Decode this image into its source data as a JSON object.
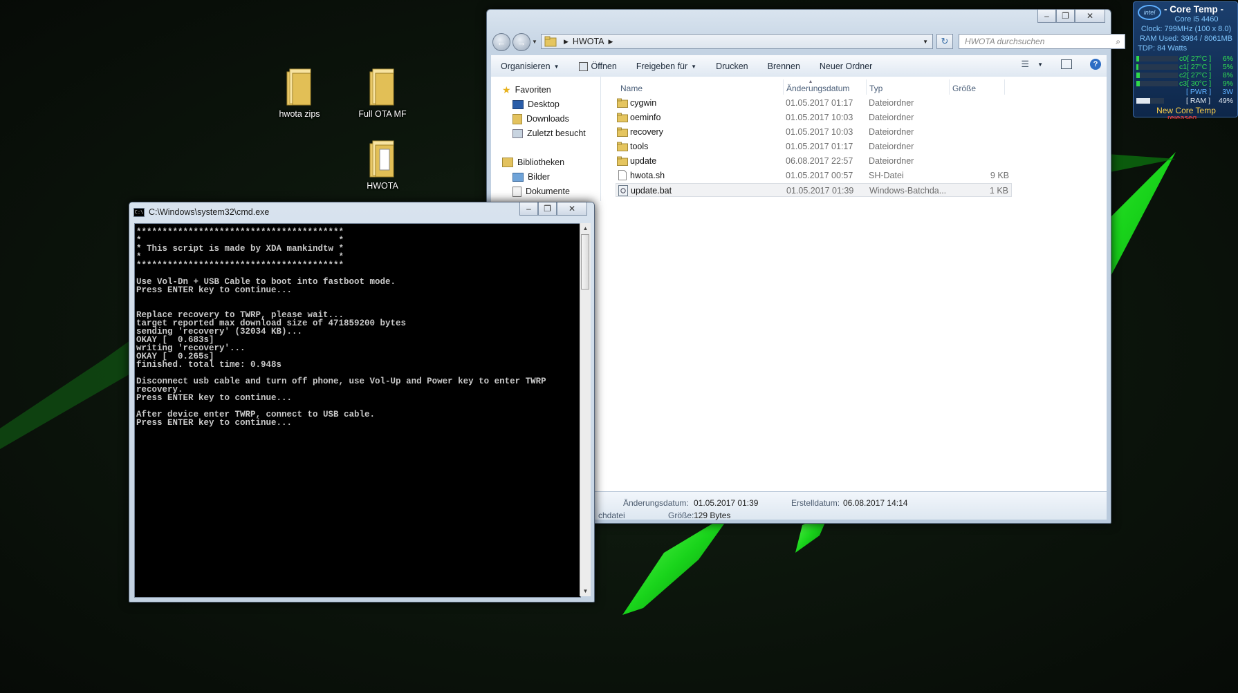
{
  "desktop": {
    "icons": [
      {
        "label": "hwota zips"
      },
      {
        "label": "Full OTA MF"
      },
      {
        "label": "HWOTA"
      }
    ]
  },
  "explorer": {
    "breadcrumb": "HWOTA",
    "search_placeholder": "HWOTA durchsuchen",
    "toolbar": {
      "organize": "Organisieren",
      "open": "Öffnen",
      "share": "Freigeben für",
      "print": "Drucken",
      "burn": "Brennen",
      "new_folder": "Neuer Ordner"
    },
    "nav": {
      "favorites": "Favoriten",
      "desktop": "Desktop",
      "downloads": "Downloads",
      "recent": "Zuletzt besucht",
      "libraries": "Bibliotheken",
      "pictures": "Bilder",
      "documents": "Dokumente"
    },
    "columns": {
      "name": "Name",
      "date": "Änderungsdatum",
      "type": "Typ",
      "size": "Größe"
    },
    "files": [
      {
        "name": "cygwin",
        "date": "01.05.2017 01:17",
        "type": "Dateiordner",
        "size": "",
        "kind": "folder"
      },
      {
        "name": "oeminfo",
        "date": "01.05.2017 10:03",
        "type": "Dateiordner",
        "size": "",
        "kind": "folder"
      },
      {
        "name": "recovery",
        "date": "01.05.2017 10:03",
        "type": "Dateiordner",
        "size": "",
        "kind": "folder"
      },
      {
        "name": "tools",
        "date": "01.05.2017 01:17",
        "type": "Dateiordner",
        "size": "",
        "kind": "folder"
      },
      {
        "name": "update",
        "date": "06.08.2017 22:57",
        "type": "Dateiordner",
        "size": "",
        "kind": "folder"
      },
      {
        "name": "hwota.sh",
        "date": "01.05.2017 00:57",
        "type": "SH-Datei",
        "size": "9 KB",
        "kind": "file"
      },
      {
        "name": "update.bat",
        "date": "01.05.2017 01:39",
        "type": "Windows-Batchda...",
        "size": "1 KB",
        "kind": "bat"
      }
    ],
    "details": {
      "modified_label": "Änderungsdatum:",
      "modified_value": "01.05.2017 01:39",
      "created_label": "Erstelldatum:",
      "created_value": "06.08.2017 14:14",
      "type_fragment": "chdatei",
      "size_label": "Größe:",
      "size_value": "129 Bytes"
    }
  },
  "cmd": {
    "title": "C:\\Windows\\system32\\cmd.exe",
    "output": "****************************************\n*                                      *\n* This script is made by XDA mankindtw *\n*                                      *\n****************************************\n\nUse Vol-Dn + USB Cable to boot into fastboot mode.\nPress ENTER key to continue...\n\n\nReplace recovery to TWRP, please wait...\ntarget reported max download size of 471859200 bytes\nsending 'recovery' (32034 KB)...\nOKAY [  0.683s]\nwriting 'recovery'...\nOKAY [  0.265s]\nfinished. total time: 0.948s\n\nDisconnect usb cable and turn off phone, use Vol-Up and Power key to enter TWRP\nrecovery.\nPress ENTER key to continue...\n\nAfter device enter TWRP, connect to USB cable.\nPress ENTER key to continue..."
  },
  "coretemp": {
    "title": "- Core Temp -",
    "cpu": "Core i5 4460",
    "clock": "Clock: 799MHz (100 x 8.0)",
    "ram": "RAM Used: 3984 / 8061MB",
    "tdp": "TDP: 84 Watts",
    "cores": [
      {
        "label": "c0[ 27°C ]",
        "value": "6%",
        "level": 0.06
      },
      {
        "label": "c1[ 27°C ]",
        "value": "5%",
        "level": 0.05
      },
      {
        "label": "c2[ 27°C ]",
        "value": "8%",
        "level": 0.08
      },
      {
        "label": "c3[ 30°C ]",
        "value": "9%",
        "level": 0.09
      }
    ],
    "pwr_label": "[ PWR ]",
    "pwr_value": "3W",
    "ram_label": "[ RAM ]",
    "ram_value": "49%",
    "ram_level": 0.49,
    "footer": "New Core Temp",
    "footer_sub": "released"
  },
  "colors": {
    "accent_green": "#2fd84a",
    "wallpaper_green": "#2bff2b"
  }
}
